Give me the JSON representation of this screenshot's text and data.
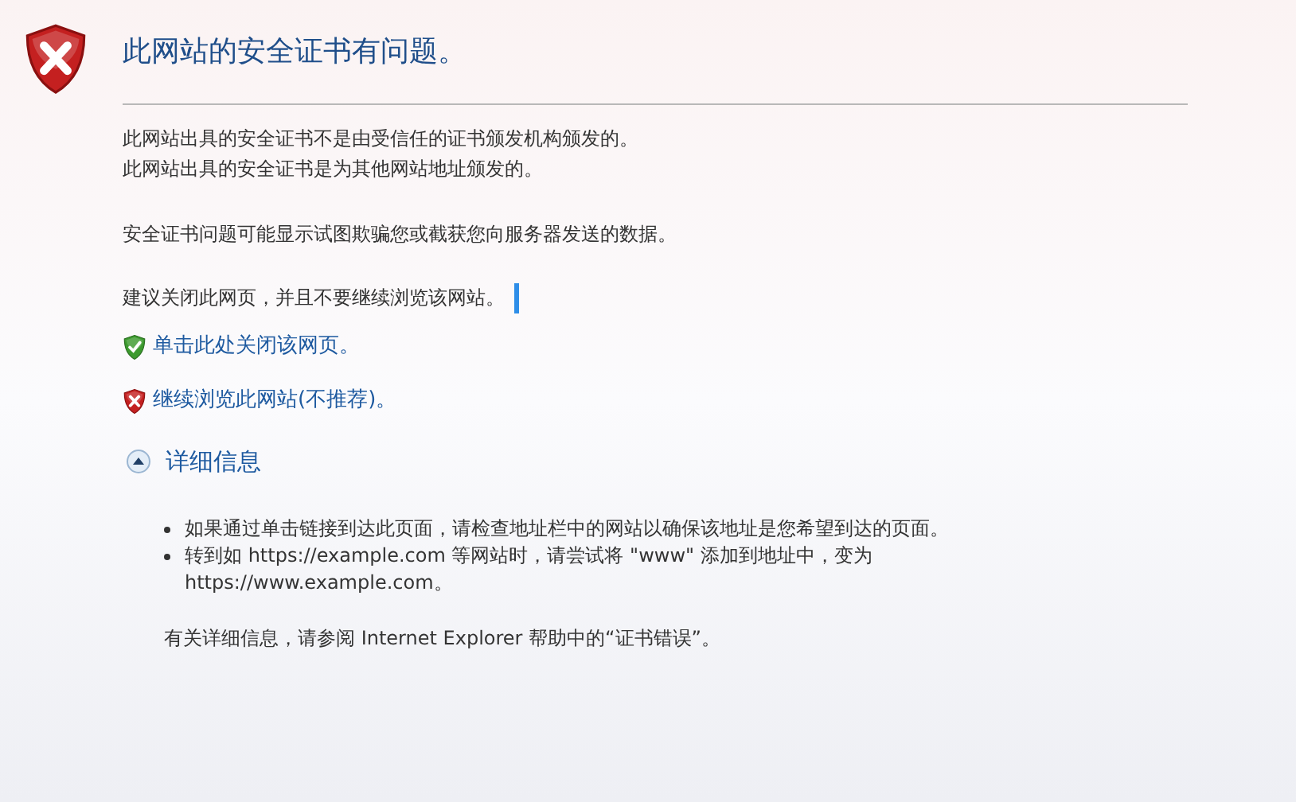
{
  "title": "此网站的安全证书有问题。",
  "messages": [
    "此网站出具的安全证书不是由受信任的证书颁发机构颁发的。",
    "此网站出具的安全证书是为其他网站地址颁发的。"
  ],
  "warning": "安全证书问题可能显示试图欺骗您或截获您向服务器发送的数据。",
  "advice": "建议关闭此网页，并且不要继续浏览该网站。",
  "links": [
    {
      "kind": "safe",
      "label": "单击此处关闭该网页。"
    },
    {
      "kind": "unsafe",
      "label": "继续浏览此网站(不推荐)。"
    }
  ],
  "details": {
    "label": "详细信息",
    "expanded": true,
    "bullets": [
      "如果通过单击链接到达此页面，请检查地址栏中的网站以确保该地址是您希望到达的页面。",
      "转到如 https://example.com 等网站时，请尝试将 \"www\" 添加到地址中，变为 https://www.example.com。"
    ],
    "footer": "有关详细信息，请参阅 Internet Explorer 帮助中的“证书错误”。"
  }
}
